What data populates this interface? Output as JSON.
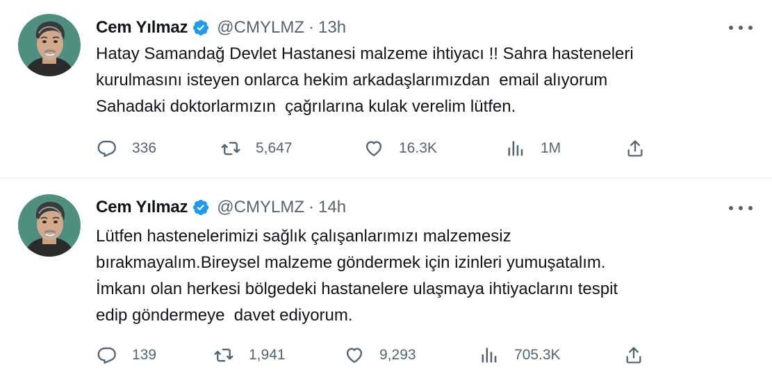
{
  "tweets": [
    {
      "author": {
        "name": "Cem Yılmaz",
        "handle": "@CMYLMZ",
        "verified": true,
        "avatar": "caricature portrait avatar"
      },
      "separator": "·",
      "time": "13h",
      "text": "Hatay Samandağ Devlet Hastanesi malzeme ihtiyacı !! Sahra hasteneleri\nkurulmasını isteyen onlarca hekim arkadaşlarımızdan  email alıyorum\nSahadaki doktorlarmızın  çağrılarına kulak verelim lütfen.",
      "stats": {
        "replies": "336",
        "retweets": "5,647",
        "likes": "16.3K",
        "views": "1M"
      }
    },
    {
      "author": {
        "name": "Cem Yılmaz",
        "handle": "@CMYLMZ",
        "verified": true,
        "avatar": "caricature portrait avatar"
      },
      "separator": "·",
      "time": "14h",
      "text": "Lütfen hastenelerimizi sağlık çalışanlarımızı malzemesiz\nbırakmayalım.Bireysel malzeme göndermek için izinleri yumuşatalım.\nİmkanı olan herkesi bölgedeki hastanelere ulaşmaya ihtiyaclarını tespit\nedip göndermeye  davet ediyorum.",
      "stats": {
        "replies": "139",
        "retweets": "1,941",
        "likes": "9,293",
        "views": "705.3K"
      }
    }
  ],
  "icons": {
    "reply": "reply-icon",
    "retweet": "retweet-icon",
    "like": "like-icon",
    "views": "views-icon",
    "share": "share-icon",
    "more": "more-icon",
    "verified": "verified-badge-icon"
  },
  "colors": {
    "verified": "#1d9bf0",
    "text": "#0f1419",
    "secondary": "#536471",
    "border": "#e6ecf0",
    "avatar_bg": "#4f8f80"
  }
}
